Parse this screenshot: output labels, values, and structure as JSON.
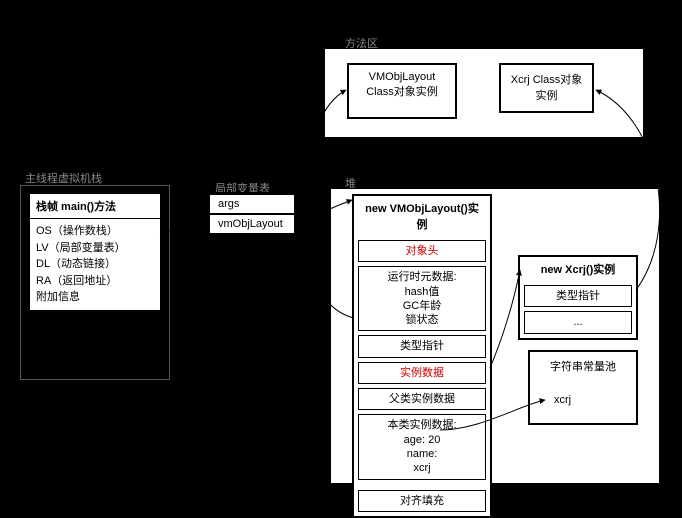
{
  "labels": {
    "method_area": "方法区",
    "thread_stack": "主线程虚拟机栈",
    "local_var_table": "局部变量表",
    "heap": "堆"
  },
  "method_area": {
    "vmobj_class": "VMObjLayout Class对象实例",
    "xcrj_class": "Xcrj Class对象实例"
  },
  "stack": {
    "title": "栈帧 main()方法",
    "os": "OS（操作数栈）",
    "lv": "LV（局部变量表）",
    "dl": "DL（动态链接）",
    "ra": "RA（返回地址）",
    "extra": "附加信息"
  },
  "locals": {
    "args": "args",
    "vmObjLayout": "vmObjLayout"
  },
  "heap_vmobj": {
    "title": "new VMObjLayout()实例",
    "obj_header": "对象头",
    "runtime_meta": "运行时元数据:",
    "hash": "hash值",
    "gc": "GC年龄",
    "lock": "锁状态",
    "type_ptr": "类型指针",
    "instance_data": "实例数据",
    "parent_data": "父类实例数据",
    "self_data_l1": "本类实例数据:",
    "self_data_l2": "age: 20",
    "self_data_l3": "name:",
    "self_data_l4": "xcrj",
    "padding": "对齐填充"
  },
  "heap_xcrj": {
    "title": "new Xcrj()实例",
    "type_ptr": "类型指针",
    "more": "..."
  },
  "string_pool": {
    "title": "字符串常量池",
    "item": "xcrj"
  },
  "watermark": ""
}
